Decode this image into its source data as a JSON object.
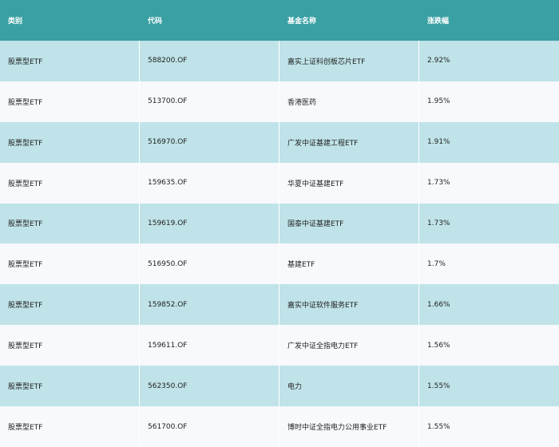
{
  "table": {
    "headers": [
      "类别",
      "代码",
      "基金名称",
      "涨跌幅"
    ],
    "rows": [
      [
        "股票型ETF",
        "588200.OF",
        "嘉实上证科创板芯片ETF",
        "2.92%"
      ],
      [
        "股票型ETF",
        "513700.OF",
        "香港医药",
        "1.95%"
      ],
      [
        "股票型ETF",
        "516970.OF",
        "广发中证基建工程ETF",
        "1.91%"
      ],
      [
        "股票型ETF",
        "159635.OF",
        "华夏中证基建ETF",
        "1.73%"
      ],
      [
        "股票型ETF",
        "159619.OF",
        "国泰中证基建ETF",
        "1.73%"
      ],
      [
        "股票型ETF",
        "516950.OF",
        "基建ETF",
        "1.7%"
      ],
      [
        "股票型ETF",
        "159852.OF",
        "嘉实中证软件服务ETF",
        "1.66%"
      ],
      [
        "股票型ETF",
        "159611.OF",
        "广发中证全指电力ETF",
        "1.56%"
      ],
      [
        "股票型ETF",
        "562350.OF",
        "电力",
        "1.55%"
      ],
      [
        "股票型ETF",
        "561700.OF",
        "博时中证全指电力公用事业ETF",
        "1.55%"
      ]
    ]
  },
  "colors": {
    "header_bg": "#3aa0a3",
    "row_alt_bg": "#bfe3e8",
    "row_plain_bg": "#f7f9fc"
  }
}
